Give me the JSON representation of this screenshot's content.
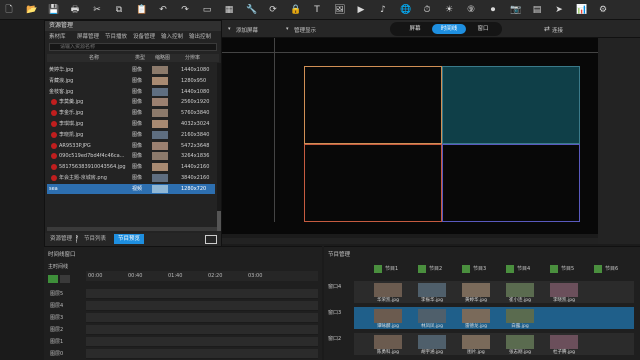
{
  "toolbar": {
    "icons": [
      "new-icon",
      "open-icon",
      "save-icon",
      "print-icon",
      "cut-icon",
      "copy-icon",
      "paste-icon",
      "undo-icon",
      "redo-icon",
      "screen-icon",
      "grid-icon",
      "tool-icon",
      "sync-icon",
      "lock-icon",
      "text-icon",
      "image-icon",
      "video-icon",
      "audio-icon",
      "web-icon",
      "clock-icon",
      "weather-icon",
      "counter-icon",
      "record-icon",
      "camera-icon",
      "layout-icon",
      "send-icon",
      "chart-icon",
      "settings-icon"
    ]
  },
  "resource": {
    "title": "资源管理",
    "tabs": [
      "素材库",
      "屏幕管理",
      "节目播放",
      "设备管理",
      "输入控制",
      "输出控制"
    ],
    "search_placeholder": "请输入资源名称",
    "columns": [
      "名称",
      "类型",
      "缩略图",
      "分辨率"
    ],
    "rows": [
      {
        "name": "黄婷华.jpg",
        "type": "图像",
        "res": "1440x1080",
        "warn": false
      },
      {
        "name": "青藏浪.jpg",
        "type": "图像",
        "res": "1280x950",
        "warn": false
      },
      {
        "name": "金枝客.jpg",
        "type": "图像",
        "res": "1440x1080",
        "warn": false
      },
      {
        "name": "李莫羹.jpg",
        "type": "图像",
        "res": "2560x1920",
        "warn": true
      },
      {
        "name": "李金乐.jpg",
        "type": "图像",
        "res": "5760x3840",
        "warn": true
      },
      {
        "name": "李琪琪.jpg",
        "type": "图像",
        "res": "4032x3024",
        "warn": true
      },
      {
        "name": "李晓凯.jpg",
        "type": "图像",
        "res": "2160x3840",
        "warn": true
      },
      {
        "name": "AR9533P.JPG",
        "type": "图像",
        "res": "5472x3648",
        "warn": true
      },
      {
        "name": "090c519ed7bd4f4c46ca...",
        "type": "图像",
        "res": "3264x1836",
        "warn": true
      },
      {
        "name": "581756383910043564.jpg",
        "type": "图像",
        "res": "1440x2160",
        "warn": true
      },
      {
        "name": "年会主题-京城房.png",
        "type": "图像",
        "res": "3840x2160",
        "warn": true
      },
      {
        "name": "sea",
        "type": "视频",
        "res": "1280x720",
        "warn": false,
        "selected": true
      }
    ],
    "bottom_tabs": [
      "资源管理",
      "节目列表",
      "节目预览"
    ],
    "active_bottom_tab": 2
  },
  "stage": {
    "add_screen_label": "添加屏幕",
    "manage_label": "管理显示",
    "screen_tabs": [
      "屏幕",
      "时间线",
      "窗口"
    ],
    "active_screen_tab": 1,
    "connect_label": "连接"
  },
  "timeline": {
    "title": "时间线窗口",
    "header": "主时间线",
    "times": [
      "00:00",
      "00:40",
      "01:40",
      "02:20",
      "03:00"
    ],
    "layers": [
      "图层5",
      "图层4",
      "图层3",
      "图层2",
      "图层1",
      "图层0"
    ]
  },
  "programs": {
    "title": "节目管理",
    "buttons": [
      "节目1",
      "节目2",
      "节目3",
      "节目4",
      "节目5",
      "节目6"
    ],
    "row_labels": [
      "窗口4",
      "窗口3",
      "窗口2"
    ],
    "thumbs": [
      [
        "华荣凯.jpg",
        "李振华.jpg",
        "黄婷华.jpg",
        "崔小连.jpg",
        "李晓凯.jpg"
      ],
      [
        "谭咏麟.jpg",
        "林凤凤.jpg",
        "雷德龙.jpg",
        "白露.jpg",
        ""
      ],
      [
        "陈勇科.jpg",
        "胡宇涵.jpg",
        "图片.jpg",
        "张志刚.jpg",
        "杜子腾.jpg"
      ]
    ]
  },
  "colors": {
    "accent": "#1e8fe0",
    "selected_row": "#2d6fb0",
    "screen_teal": "#0f3f48",
    "warn": "#c01e1e"
  }
}
